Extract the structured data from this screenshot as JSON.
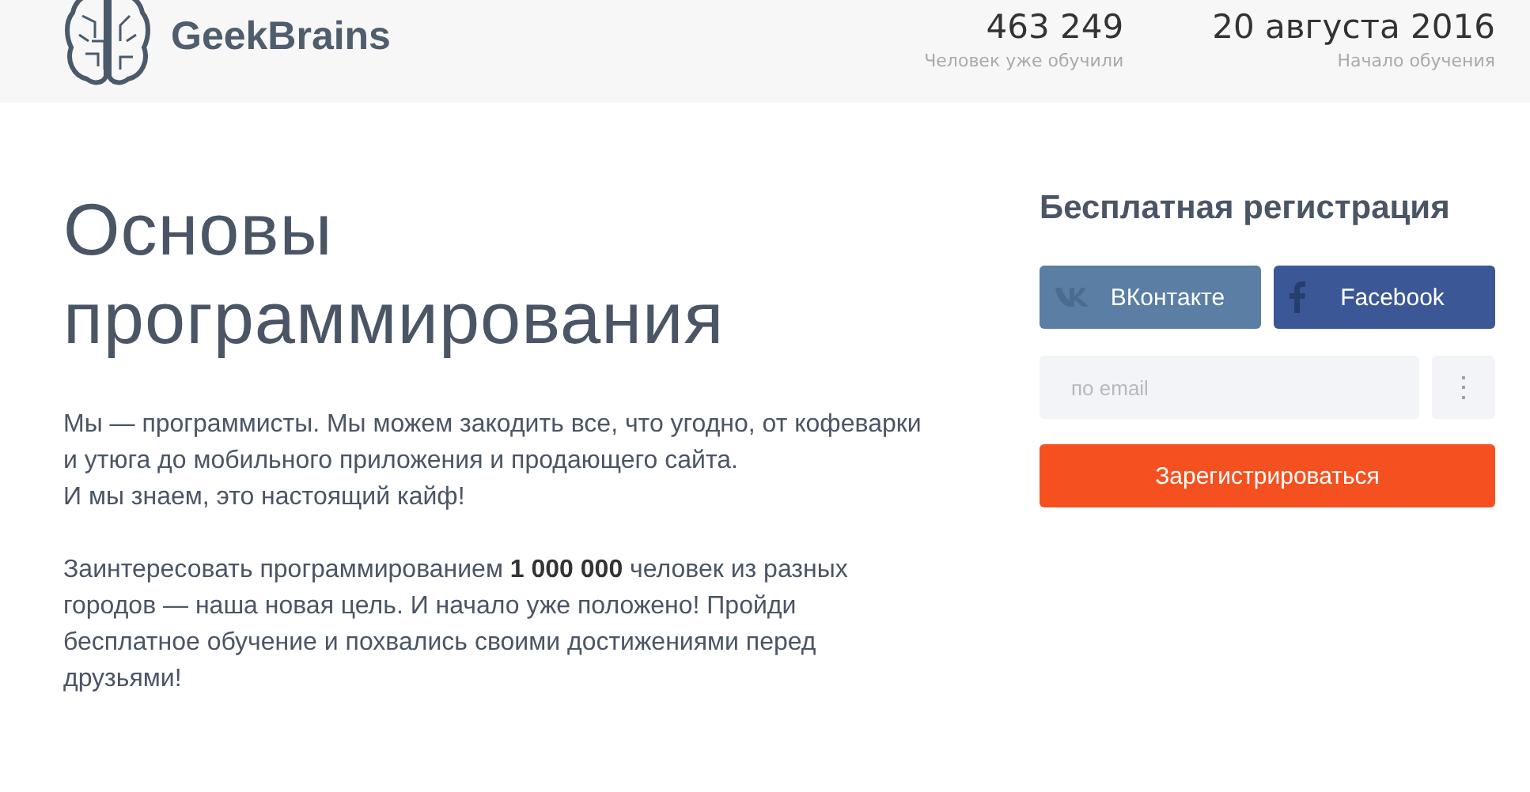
{
  "header": {
    "logo": "GeekBrains",
    "stats": [
      {
        "value": "463 249",
        "caption": "Человек уже обучили"
      },
      {
        "value": "20 августа 2016",
        "caption": "Начало обучения"
      }
    ]
  },
  "hero": {
    "title_lines": [
      "Основы",
      "программирования"
    ],
    "paragraphs": [
      [
        "Мы — программисты. Мы можем закодить все, что угодно, от кофеварки",
        "и утюга до мобильного приложения и продающего сайта.",
        "И мы знаем, это настоящий кайф!"
      ],
      [
        "Заинтересовать программированием **1 000 000** человек из разных",
        "городов — наша новая цель. И начало уже положено! Пройди",
        "бесплатное обучение и похвались своими достижениями перед",
        "друзьями!"
      ]
    ]
  },
  "registration": {
    "title": "Бесплатная регистрация",
    "social": [
      {
        "kind": "vk",
        "label": "ВКонтакте"
      },
      {
        "kind": "facebook",
        "label": "Facebook"
      }
    ],
    "email": {
      "placeholder": "по email"
    },
    "more": "⋮",
    "submit": "Зарегистрироваться"
  }
}
